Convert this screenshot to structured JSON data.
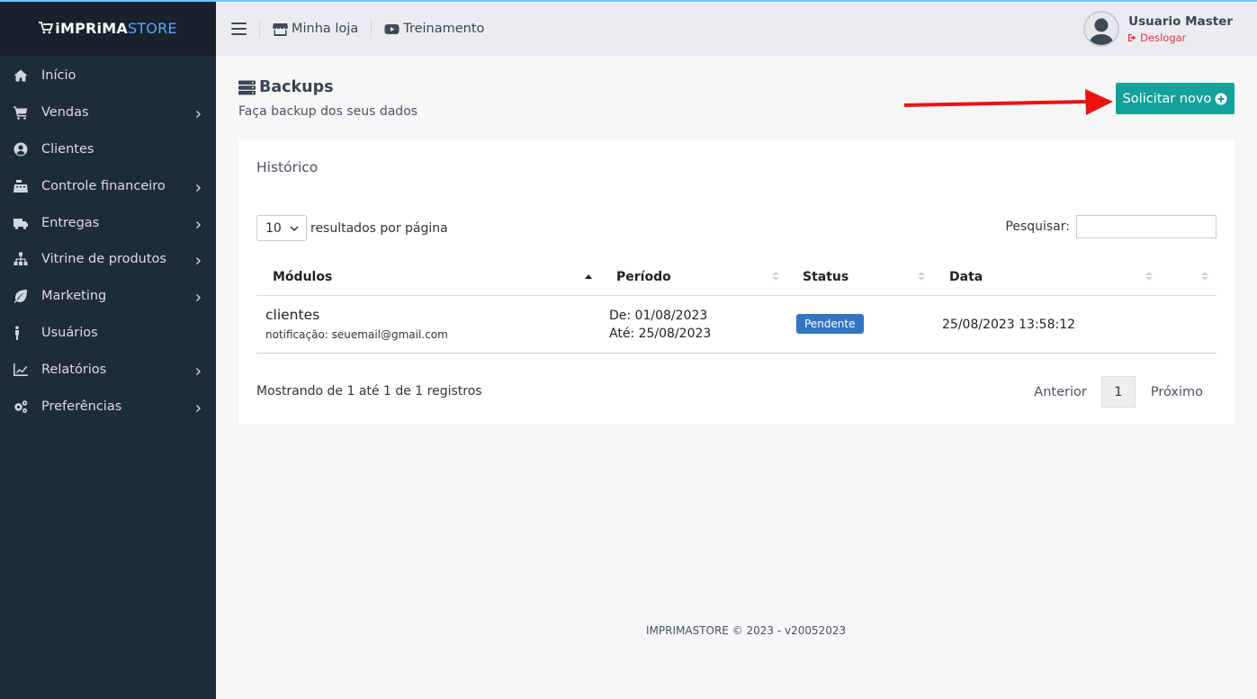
{
  "brand": {
    "logo_strong": "iMPRiMA",
    "logo_light": "STORE"
  },
  "sidebar": {
    "items": [
      {
        "label": "Início",
        "icon": "home-icon",
        "has_submenu": false
      },
      {
        "label": "Vendas",
        "icon": "cart-icon",
        "has_submenu": true
      },
      {
        "label": "Clientes",
        "icon": "user-circle-icon",
        "has_submenu": false
      },
      {
        "label": "Controle financeiro",
        "icon": "cash-register-icon",
        "has_submenu": true
      },
      {
        "label": "Entregas",
        "icon": "truck-icon",
        "has_submenu": true
      },
      {
        "label": "Vitrine de produtos",
        "icon": "sitemap-icon",
        "has_submenu": true
      },
      {
        "label": "Marketing",
        "icon": "leaf-icon",
        "has_submenu": true
      },
      {
        "label": "Usuários",
        "icon": "person-icon",
        "has_submenu": false
      },
      {
        "label": "Relatórios",
        "icon": "line-chart-icon",
        "has_submenu": true
      },
      {
        "label": "Preferências",
        "icon": "cogs-icon",
        "has_submenu": true
      }
    ]
  },
  "header": {
    "links": [
      {
        "label": "Minha loja",
        "icon": "store-icon"
      },
      {
        "label": "Treinamento",
        "icon": "youtube-icon"
      }
    ],
    "user": {
      "name": "Usuario Master",
      "logout_label": "Deslogar"
    }
  },
  "page": {
    "title": "Backups",
    "subtitle": "Faça backup dos seus dados",
    "new_button": "Solicitar novo"
  },
  "history": {
    "title": "Histórico",
    "page_length": "10",
    "page_length_suffix": "resultados por página",
    "search_label": "Pesquisar:",
    "columns": [
      "Módulos",
      "Período",
      "Status",
      "Data"
    ],
    "rows": [
      {
        "module": "clientes",
        "note": "notificação: seuemail@gmail.com",
        "period_from": "De: 01/08/2023",
        "period_to": "Até: 25/08/2023",
        "status": "Pendente",
        "date": "25/08/2023 13:58:12"
      }
    ],
    "info": "Mostrando de 1 até 1 de 1 registros",
    "pagination": {
      "prev": "Anterior",
      "current": "1",
      "next": "Próximo"
    }
  },
  "footer": "IMPRIMASTORE © 2023 - v20052023",
  "colors": {
    "sidebar": "#1f2b38",
    "accent": "#12a29a",
    "badge": "#3374c3",
    "logout": "#e2344b",
    "arrow": "#ee1111"
  }
}
